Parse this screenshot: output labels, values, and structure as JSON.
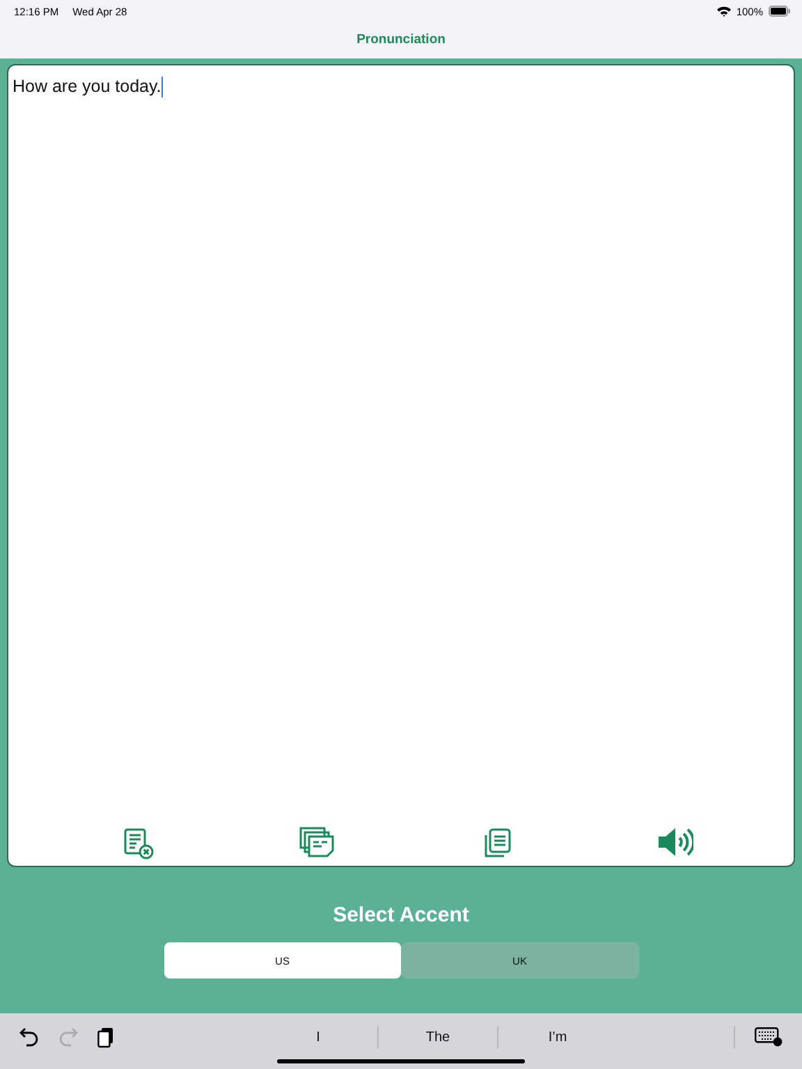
{
  "status_bar": {
    "time": "12:16 PM",
    "date": "Wed Apr 28",
    "battery": "100%"
  },
  "nav_bar": {
    "title": "Pronunciation"
  },
  "editor": {
    "value": "How are you today."
  },
  "accent": {
    "title": "Select Accent",
    "options": [
      {
        "label": "US",
        "selected": true
      },
      {
        "label": "UK",
        "selected": false
      }
    ]
  },
  "keyboard_bar": {
    "suggestions": [
      "I",
      "The",
      "I’m"
    ],
    "redo_disabled": true
  }
}
